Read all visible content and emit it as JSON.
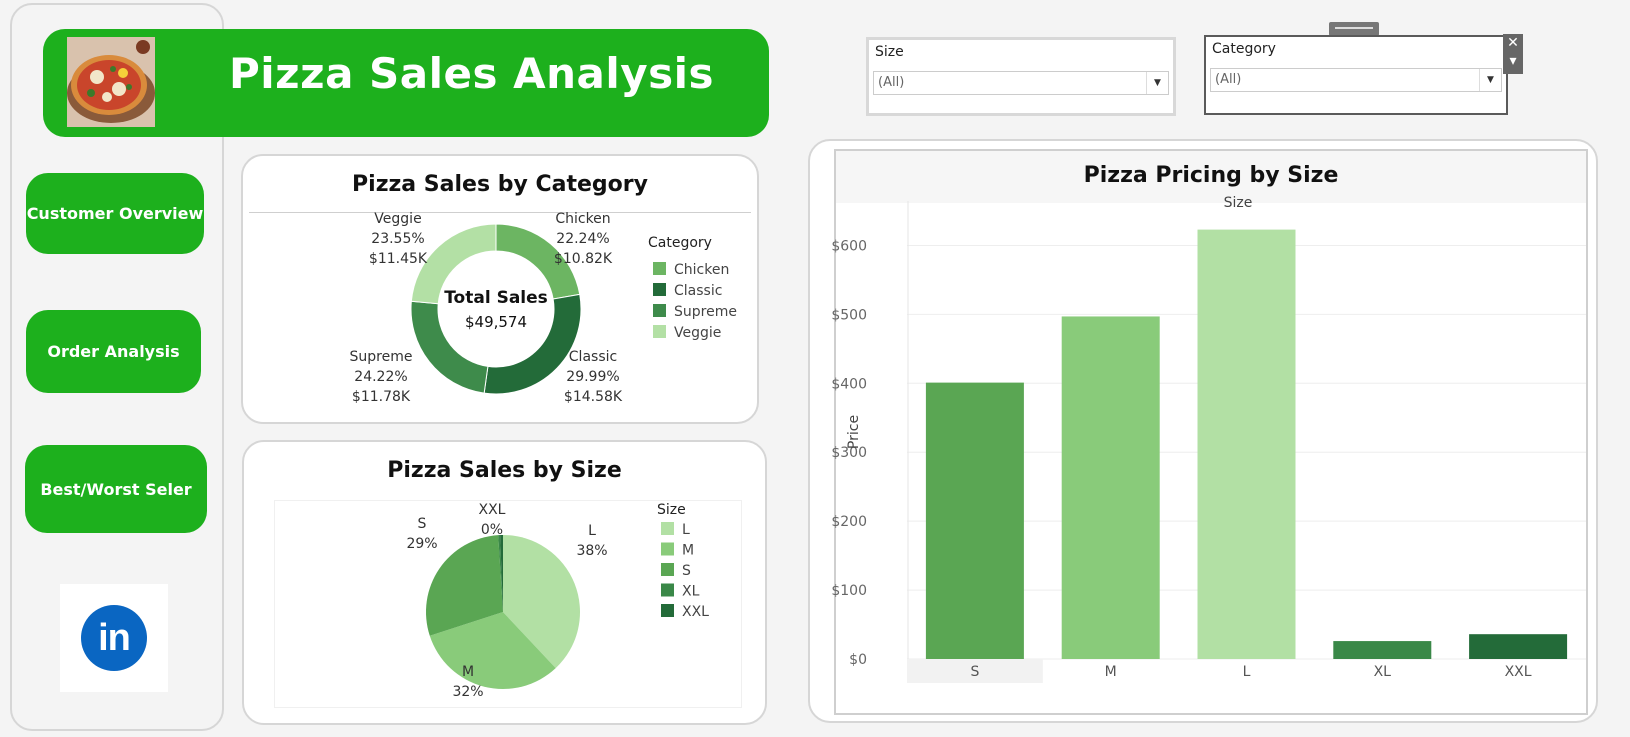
{
  "header": {
    "title": "Pizza Sales Analysis",
    "logo_icon": "pizza-image"
  },
  "nav": {
    "customer_overview": "Customer Overview",
    "order_analysis": "Order Analysis",
    "best_worst": "Best/Worst Seler",
    "social_icon": "linkedin-icon",
    "social_label": "in"
  },
  "filters": {
    "size": {
      "label": "Size",
      "value": "(All)"
    },
    "category": {
      "label": "Category",
      "value": "(All)"
    },
    "close_glyph": "✕",
    "menu_glyph": "▾"
  },
  "colors": {
    "brand_green": "#1db01d",
    "chicken": "#6cb562",
    "classic": "#236b39",
    "supreme": "#3e8b4b",
    "veggie": "#b3e0a5",
    "L": "#b2e0a4",
    "M": "#89cb7a",
    "S": "#5aa653",
    "XL": "#3a8848",
    "XXL": "#236b39"
  },
  "chart_data": [
    {
      "type": "pie",
      "variant": "donut",
      "title": "Pizza Sales by Category",
      "center_label": "Total Sales",
      "center_value": "$49,574",
      "legend_title": "Category",
      "legend_position": "right",
      "legend": [
        "Chicken",
        "Classic",
        "Supreme",
        "Veggie"
      ],
      "slices": [
        {
          "name": "Chicken",
          "percent": 22.24,
          "percent_label": "22.24%",
          "value_label": "$10.82K"
        },
        {
          "name": "Classic",
          "percent": 29.99,
          "percent_label": "29.99%",
          "value_label": "$14.58K"
        },
        {
          "name": "Supreme",
          "percent": 24.22,
          "percent_label": "24.22%",
          "value_label": "$11.78K"
        },
        {
          "name": "Veggie",
          "percent": 23.55,
          "percent_label": "23.55%",
          "value_label": "$11.45K"
        }
      ]
    },
    {
      "type": "pie",
      "title": "Pizza Sales by Size",
      "legend_title": "Size",
      "legend_position": "right",
      "legend": [
        "L",
        "M",
        "S",
        "XL",
        "XXL"
      ],
      "slices": [
        {
          "name": "L",
          "percent": 38,
          "percent_label": "38%"
        },
        {
          "name": "M",
          "percent": 32,
          "percent_label": "32%"
        },
        {
          "name": "S",
          "percent": 29,
          "percent_label": "29%"
        },
        {
          "name": "XL",
          "percent": 0.4,
          "percent_label": ""
        },
        {
          "name": "XXL",
          "percent": 0.6,
          "percent_label": "0%"
        }
      ]
    },
    {
      "type": "bar",
      "title": "Pizza Pricing by Size",
      "xlabel": "Size",
      "ylabel": "Price",
      "categories": [
        "S",
        "M",
        "L",
        "XL",
        "XXL"
      ],
      "values": [
        401,
        497,
        623,
        26,
        36
      ],
      "ylim": [
        0,
        650
      ],
      "yticks": [
        0,
        100,
        200,
        300,
        400,
        500,
        600
      ],
      "ytick_labels": [
        "$0",
        "$100",
        "$200",
        "$300",
        "$400",
        "$500",
        "$600"
      ],
      "grid": true
    }
  ]
}
